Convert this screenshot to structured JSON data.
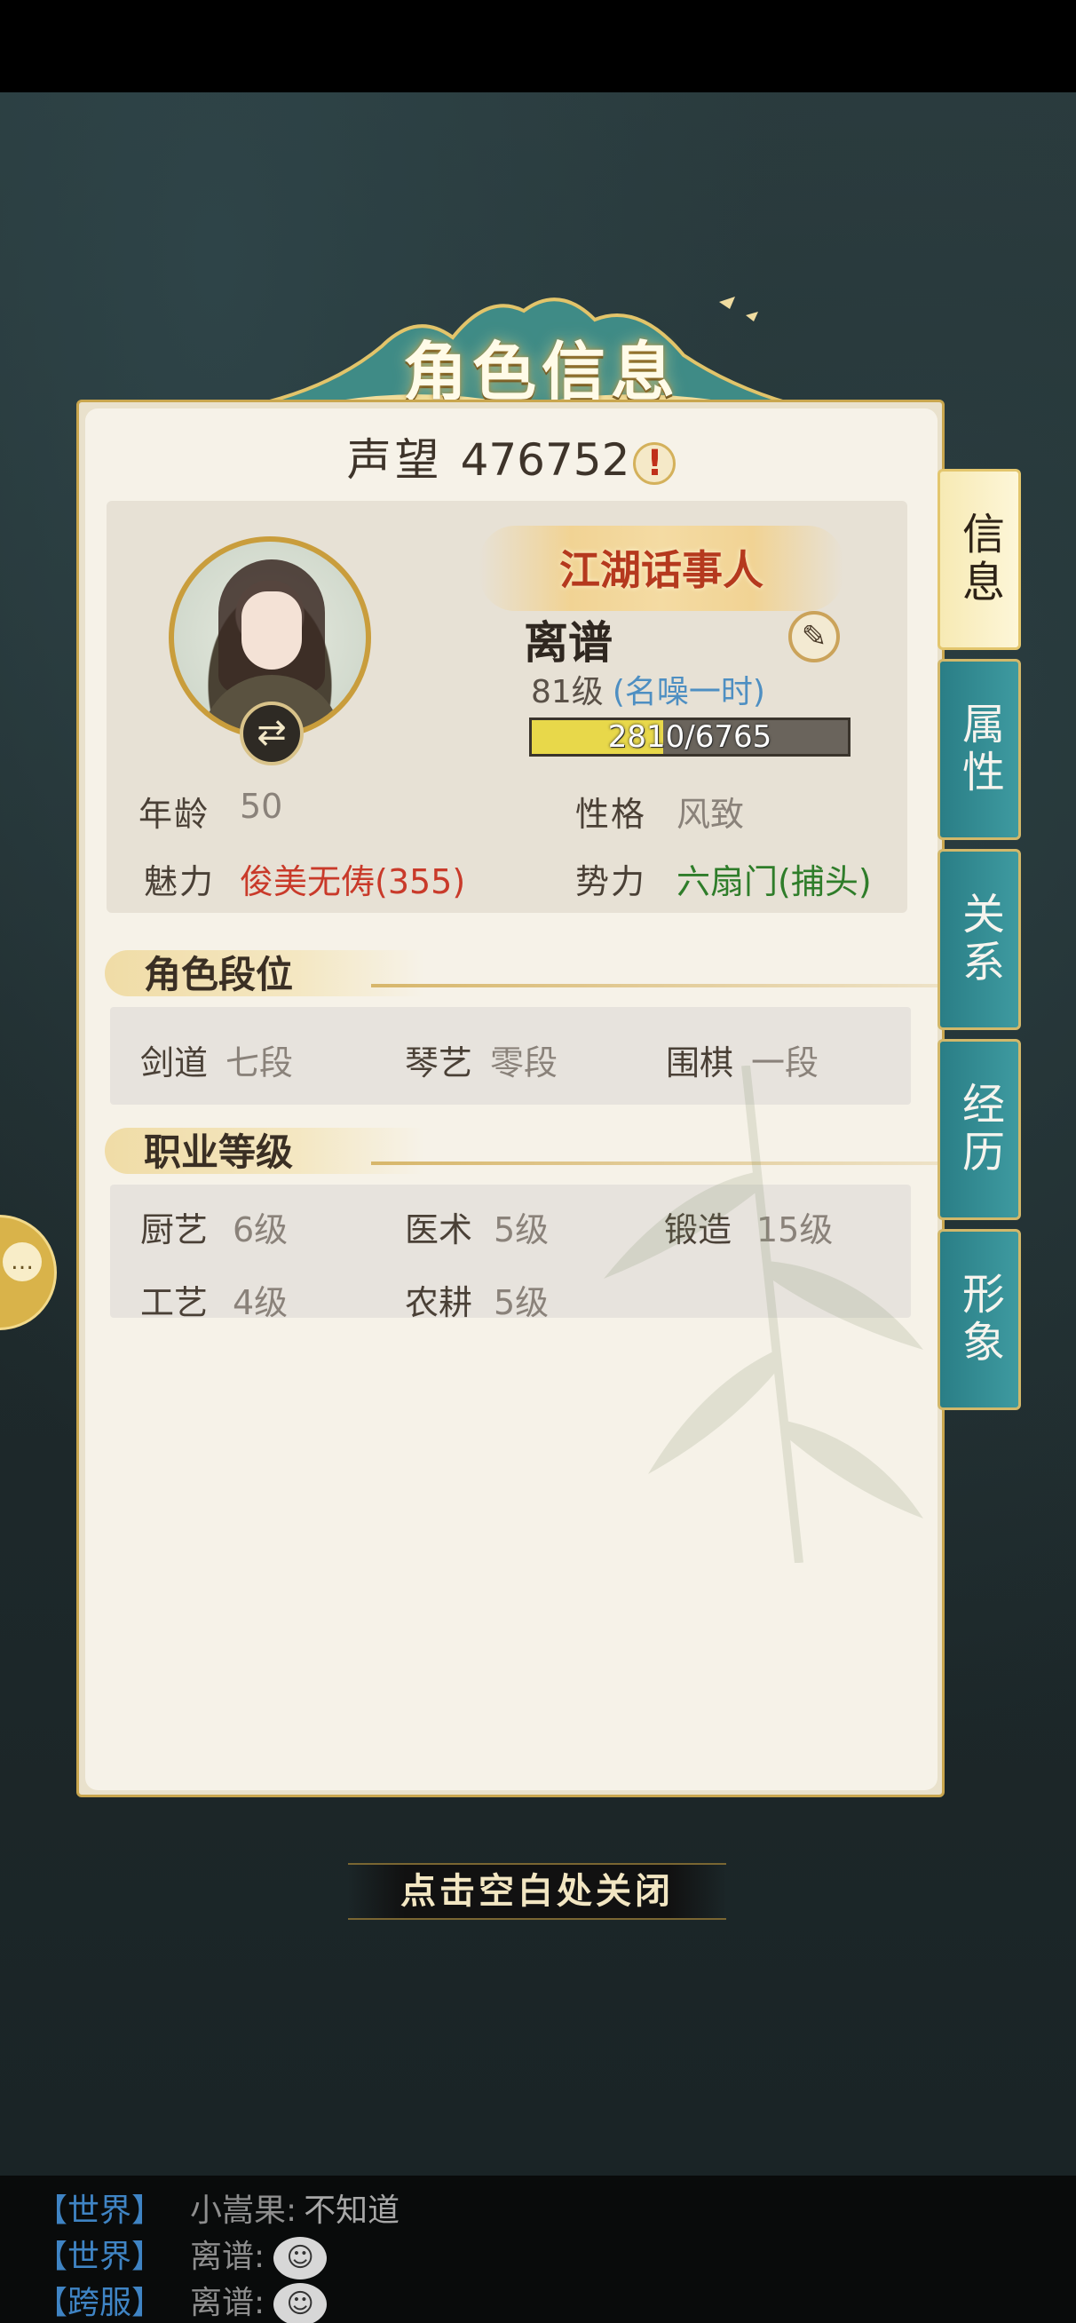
{
  "title": "角色信息",
  "fame": {
    "label": "声望",
    "value": "476752",
    "icon": "exclamation-icon"
  },
  "profile": {
    "rank_title": "江湖话事人",
    "name": "离谱",
    "level": "81级",
    "level_title": "(名噪一时)",
    "exp_text": "2810/6765",
    "exp_fraction": 0.415,
    "stats": {
      "age_label": "年龄",
      "age_value": "50",
      "personality_label": "性格",
      "personality_value": "风致",
      "charm_label": "魅力",
      "charm_value": "俊美无俦(355)",
      "faction_label": "势力",
      "faction_value": "六扇门(捕头)"
    }
  },
  "rank_section": {
    "title": "角色段位",
    "items": [
      {
        "label": "剑道",
        "value": "七段"
      },
      {
        "label": "琴艺",
        "value": "零段"
      },
      {
        "label": "围棋",
        "value": "一段"
      }
    ]
  },
  "career_section": {
    "title": "职业等级",
    "items": [
      {
        "label": "厨艺",
        "value": "6级"
      },
      {
        "label": "医术",
        "value": "5级"
      },
      {
        "label": "锻造",
        "value": "15级"
      },
      {
        "label": "工艺",
        "value": "4级"
      },
      {
        "label": "农耕",
        "value": "5级"
      }
    ]
  },
  "tabs": [
    {
      "label": "信息",
      "active": true
    },
    {
      "label": "属性",
      "active": false
    },
    {
      "label": "关系",
      "active": false
    },
    {
      "label": "经历",
      "active": false
    },
    {
      "label": "形象",
      "active": false
    }
  ],
  "close_hint": "点击空白处关闭",
  "chat": [
    {
      "tag": "【世界】",
      "user": "小嵩果:",
      "msg": "不知道"
    },
    {
      "tag": "【世界】",
      "user": "离谱:",
      "emoji": "emoji-sticker-icon"
    },
    {
      "tag": "【跨服】",
      "user": "离谱:",
      "emoji": "emoji-sticker-icon"
    }
  ],
  "colors": {
    "tab_active": "#f7eab4",
    "tab_inactive": "#2a7e86",
    "rank_red": "#b5391e",
    "charm_red": "#c93a2a",
    "faction_green": "#2f7d2a",
    "level_title_blue": "#4e8fc2",
    "chat_tag_blue": "#3f84c4"
  }
}
